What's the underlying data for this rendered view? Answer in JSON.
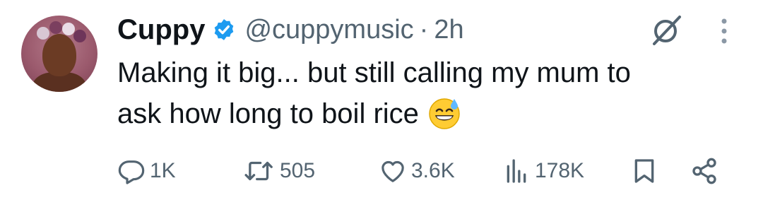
{
  "user": {
    "name": "Cuppy",
    "handle": "@cuppymusic",
    "separator": "·",
    "time": "2h",
    "verified": true
  },
  "tweet": {
    "lines": [
      "Making it big... but still calling my mum to",
      "ask how long to boil rice"
    ],
    "emoji": "grinning-face-with-sweat"
  },
  "actions": {
    "replies": "1K",
    "reposts": "505",
    "likes": "3.6K",
    "views": "178K"
  },
  "icons": {
    "verified": "verified-badge-icon",
    "grok": "grok-icon",
    "more": "more-vertical-icon",
    "reply": "reply-icon",
    "repost": "repost-icon",
    "like": "heart-icon",
    "views": "views-icon",
    "bookmark": "bookmark-icon",
    "share": "share-icon"
  },
  "colors": {
    "text": "#0f1419",
    "secondary": "#536471",
    "verified": "#1d9bf0"
  }
}
